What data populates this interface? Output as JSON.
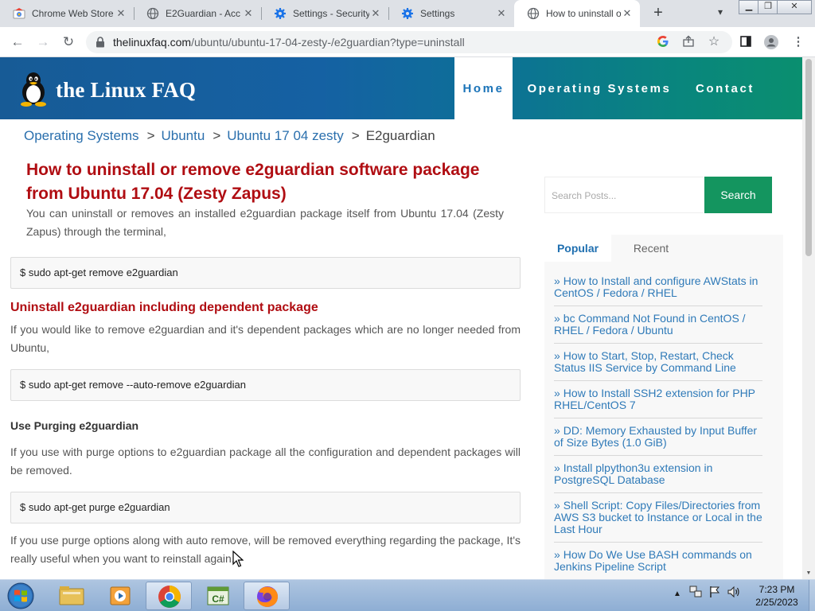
{
  "browser": {
    "tabs": [
      {
        "label": "Chrome Web Store",
        "icon": "chrome-web-store-icon"
      },
      {
        "label": "E2Guardian - Acc",
        "icon": "globe-icon"
      },
      {
        "label": "Settings - Security",
        "icon": "gear-icon"
      },
      {
        "label": "Settings",
        "icon": "gear-icon"
      },
      {
        "label": "How to uninstall o",
        "icon": "globe-icon",
        "active": true
      }
    ],
    "url_domain": "thelinuxfaq.com",
    "url_path": "/ubuntu/ubuntu-17-04-zesty-/e2guardian?type=uninstall"
  },
  "site": {
    "logo_text": "the Linux FAQ",
    "nav": {
      "home": "Home",
      "operating_systems": "Operating Systems",
      "contact": "Contact"
    },
    "colors": {
      "header_start": "#175b96",
      "header_end": "#0a8f6f",
      "title_red": "#b00d12",
      "link_blue": "#2a6fad",
      "search_green": "#14955f"
    }
  },
  "breadcrumb": {
    "items": [
      "Operating Systems",
      "Ubuntu",
      "Ubuntu 17 04 zesty"
    ],
    "current": "E2guardian",
    "separator": ">"
  },
  "article": {
    "title": "How to uninstall or remove e2guardian software package from Ubuntu 17.04 (Zesty Zapus)",
    "intro": "You can uninstall or removes an installed e2guardian package itself from Ubuntu 17.04 (Zesty Zapus) through the terminal,",
    "cmd_remove": "$ sudo apt-get remove e2guardian",
    "heading_dependent": "Uninstall e2guardian including dependent package",
    "para_dependent": "If you would like to remove e2guardian and it's dependent packages which are no longer needed from Ubuntu,",
    "cmd_autoremove": "$ sudo apt-get remove --auto-remove e2guardian",
    "heading_purge": "Use Purging e2guardian",
    "para_purge": "If you use with purge options to e2guardian package all the configuration and dependent packages will be removed.",
    "cmd_purge": "$ sudo apt-get purge e2guardian",
    "para_purge_auto": "If you use purge options along with auto remove, will be removed everything regarding the package, It's really useful when you want to reinstall again."
  },
  "sidebar": {
    "search_placeholder": "Search Posts...",
    "search_button": "Search",
    "tab_popular": "Popular",
    "tab_recent": "Recent",
    "raquo": "»",
    "popular": [
      "How to Install and configure AWStats in CentOS / Fedora / RHEL",
      "bc Command Not Found in CentOS / RHEL / Fedora / Ubuntu",
      "How to Start, Stop, Restart, Check Status IIS Service by Command Line",
      "How to Install SSH2 extension for PHP RHEL/CentOS 7",
      "DD: Memory Exhausted by Input Buffer of Size Bytes (1.0 GiB)",
      "Install plpython3u extension in PostgreSQL Database",
      "Shell Script: Copy Files/Directories from AWS S3 bucket to Instance or Local in the Last Hour",
      "How Do We Use BASH commands on Jenkins Pipeline Script"
    ]
  },
  "taskbar": {
    "time": "7:23 PM",
    "date": "2/25/2023"
  }
}
